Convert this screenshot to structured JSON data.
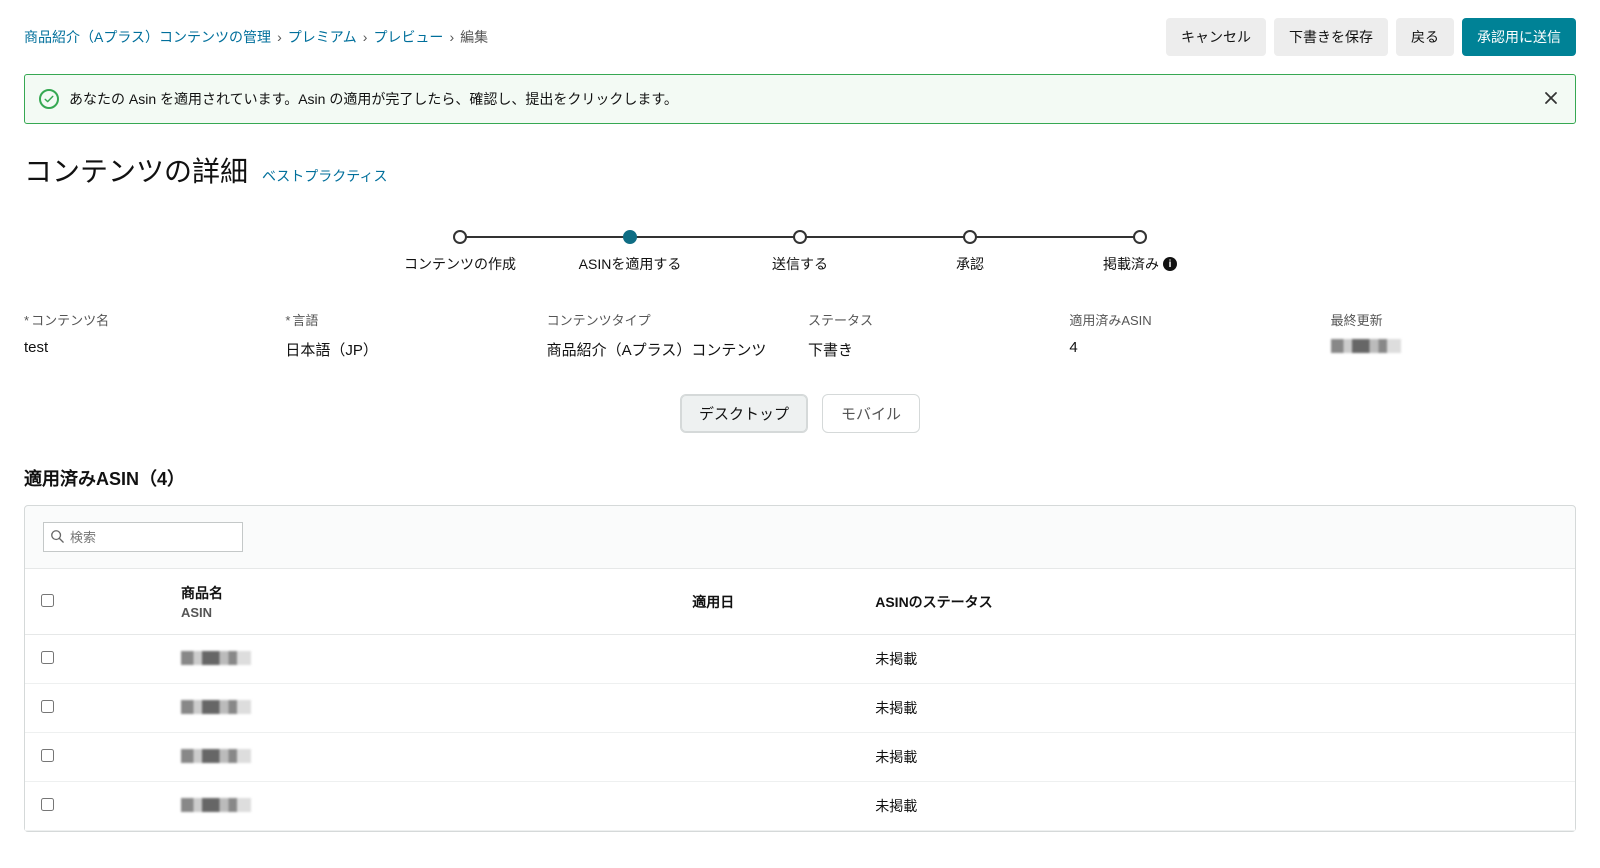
{
  "breadcrumb": {
    "root": "商品紹介（Aプラス）コンテンツの管理",
    "items": [
      "プレミアム",
      "プレビュー"
    ],
    "current": "編集"
  },
  "actions": {
    "cancel": "キャンセル",
    "save_draft": "下書きを保存",
    "back": "戻る",
    "submit": "承認用に送信"
  },
  "alert": {
    "message": "あなたの Asin を適用されています。Asin の適用が完了したら、確認し、提出をクリックします。"
  },
  "title": "コンテンツの詳細",
  "best_practices": "ベストプラクティス",
  "stepper": {
    "steps": [
      {
        "label": "コンテンツの作成"
      },
      {
        "label": "ASINを適用する"
      },
      {
        "label": "送信する"
      },
      {
        "label": "承認"
      },
      {
        "label": "掲載済み",
        "info": true
      }
    ],
    "active_index": 1
  },
  "details": {
    "labels": {
      "content_name": "コンテンツ名",
      "language": "言語",
      "content_type": "コンテンツタイプ",
      "status": "ステータス",
      "applied_asin": "適用済みASIN",
      "last_updated": "最終更新"
    },
    "values": {
      "content_name": "test",
      "language": "日本語（JP）",
      "content_type": "商品紹介（Aプラス）コンテンツ",
      "status": "下書き",
      "applied_asin": "4",
      "last_updated": ""
    }
  },
  "view_toggle": {
    "desktop": "デスクトップ",
    "mobile": "モバイル",
    "selected": "desktop"
  },
  "asin_section": {
    "title": "適用済みASIN（4）",
    "search_placeholder": "検索",
    "columns": {
      "name": "商品名",
      "name_sub": "ASIN",
      "applied_date": "適用日",
      "status": "ASINのステータス"
    },
    "rows": [
      {
        "status": "未掲載"
      },
      {
        "status": "未掲載"
      },
      {
        "status": "未掲載"
      },
      {
        "status": "未掲載"
      }
    ]
  }
}
